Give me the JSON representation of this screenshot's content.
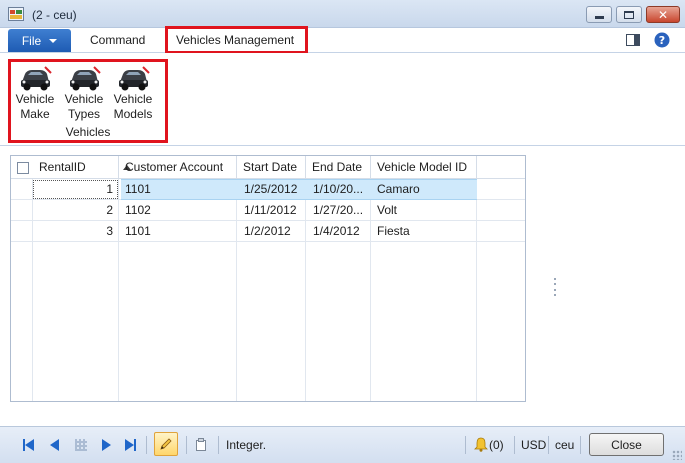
{
  "window": {
    "title": "(2 - ceu)",
    "controls": [
      "minimize",
      "maximize",
      "close"
    ]
  },
  "menu": {
    "file_label": "File",
    "tabs": [
      {
        "label": "Command"
      },
      {
        "label": "Vehicles Management",
        "active": true
      }
    ],
    "right_icons": [
      "window-layout-icon",
      "help-icon"
    ]
  },
  "ribbon": {
    "group_label": "Vehicles",
    "buttons": [
      {
        "label": "Vehicle\nMake",
        "icon": "car-icon"
      },
      {
        "label": "Vehicle\nTypes",
        "icon": "car-icon"
      },
      {
        "label": "Vehicle\nModels",
        "icon": "car-icon"
      }
    ]
  },
  "grid": {
    "columns": [
      "RentalID",
      "Customer Account",
      "Start Date",
      "End Date",
      "Vehicle Model ID"
    ],
    "sort_column": "RentalID",
    "sort_direction": "ascending",
    "rows": [
      {
        "rental_id": "1",
        "customer_account": "1101",
        "start_date": "1/25/2012",
        "end_date": "1/10/20...",
        "vehicle_model_id": "Camaro",
        "selected": true
      },
      {
        "rental_id": "2",
        "customer_account": "1102",
        "start_date": "1/11/2012",
        "end_date": "1/27/20...",
        "vehicle_model_id": "Volt"
      },
      {
        "rental_id": "3",
        "customer_account": "1101",
        "start_date": "1/2/2012",
        "end_date": "1/4/2012",
        "vehicle_model_id": "Fiesta"
      }
    ]
  },
  "statusbar": {
    "field_type": "Integer.",
    "notifications": "(0)",
    "currency": "USD",
    "company": "ceu",
    "close_label": "Close"
  },
  "colors": {
    "file_button": "#1e5bb3",
    "highlight_frame": "#e0141e",
    "selected_row": "#cfe9fb",
    "nav_arrows": "#1f66c9"
  }
}
